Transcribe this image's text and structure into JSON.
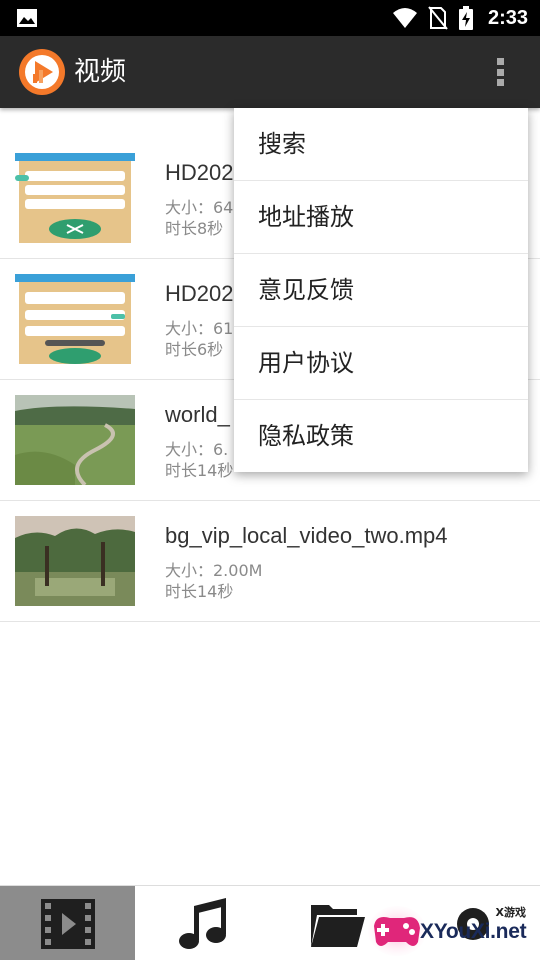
{
  "status_bar": {
    "time": "2:33",
    "icons": [
      "gallery-icon",
      "wifi-icon",
      "no-sim-icon",
      "battery-charging-icon"
    ]
  },
  "app_bar": {
    "title": "视频",
    "logo": "play-logo-icon",
    "overflow": "more-vert-icon"
  },
  "videos": [
    {
      "name": "HD202",
      "size": "大小：64",
      "duration": "时长8秒",
      "thumb": "app-screenshot"
    },
    {
      "name": "HD202",
      "size": "大小：61",
      "duration": "时长6秒",
      "thumb": "app-screenshot"
    },
    {
      "name": "world_",
      "size": "大小：6.",
      "duration": "时长14秒",
      "thumb": "landscape-road"
    },
    {
      "name": "bg_vip_local_video_two.mp4",
      "size": "大小：2.00M",
      "duration": "时长14秒",
      "thumb": "landscape-trees"
    }
  ],
  "menu": {
    "items": [
      "搜索",
      "地址播放",
      "意见反馈",
      "用户协议",
      "隐私政策"
    ]
  },
  "bottom_nav": {
    "tabs": [
      "video-tab-icon",
      "music-tab-icon",
      "folder-tab-icon",
      "game-tab-icon"
    ],
    "active_index": 0
  },
  "watermark": {
    "small": "X游戏",
    "main": "XYouXi.net"
  },
  "colors": {
    "app_bar": "#2b2b2b",
    "accent": "#f4792a",
    "active_tab": "#8c8c8c"
  }
}
